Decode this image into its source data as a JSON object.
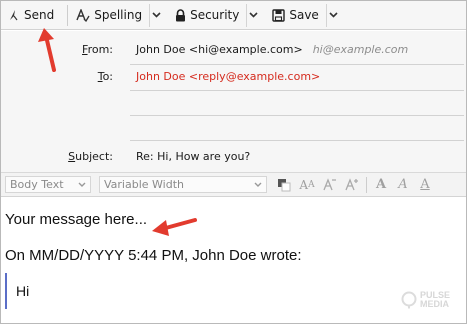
{
  "toolbar": {
    "send": "Send",
    "spelling": "Spelling",
    "security": "Security",
    "save": "Save"
  },
  "header": {
    "from_label_ul": "F",
    "from_label_rest": "rom:",
    "from_value": "John Doe <hi@example.com>",
    "from_hint": "hi@example.com",
    "to_label_ul": "T",
    "to_label_rest": "o:",
    "to_value": "John Doe <reply@example.com>",
    "subject_label_ul": "S",
    "subject_label_rest": "ubject:",
    "subject_value": "Re: Hi, How are you?"
  },
  "format": {
    "paragraph_style": "Body Text",
    "font": "Variable Width"
  },
  "body": {
    "message": "Your message here...",
    "quote_header": "On MM/DD/YYYY 5:44 PM, John Doe wrote:",
    "quoted_text": "Hi"
  },
  "watermark": {
    "line1": "PULSE",
    "line2": "MEDIA"
  },
  "colors": {
    "annotation_arrow": "#e23b2e",
    "to_text": "#d52b1e",
    "quote_bar": "#5b6ec7"
  }
}
